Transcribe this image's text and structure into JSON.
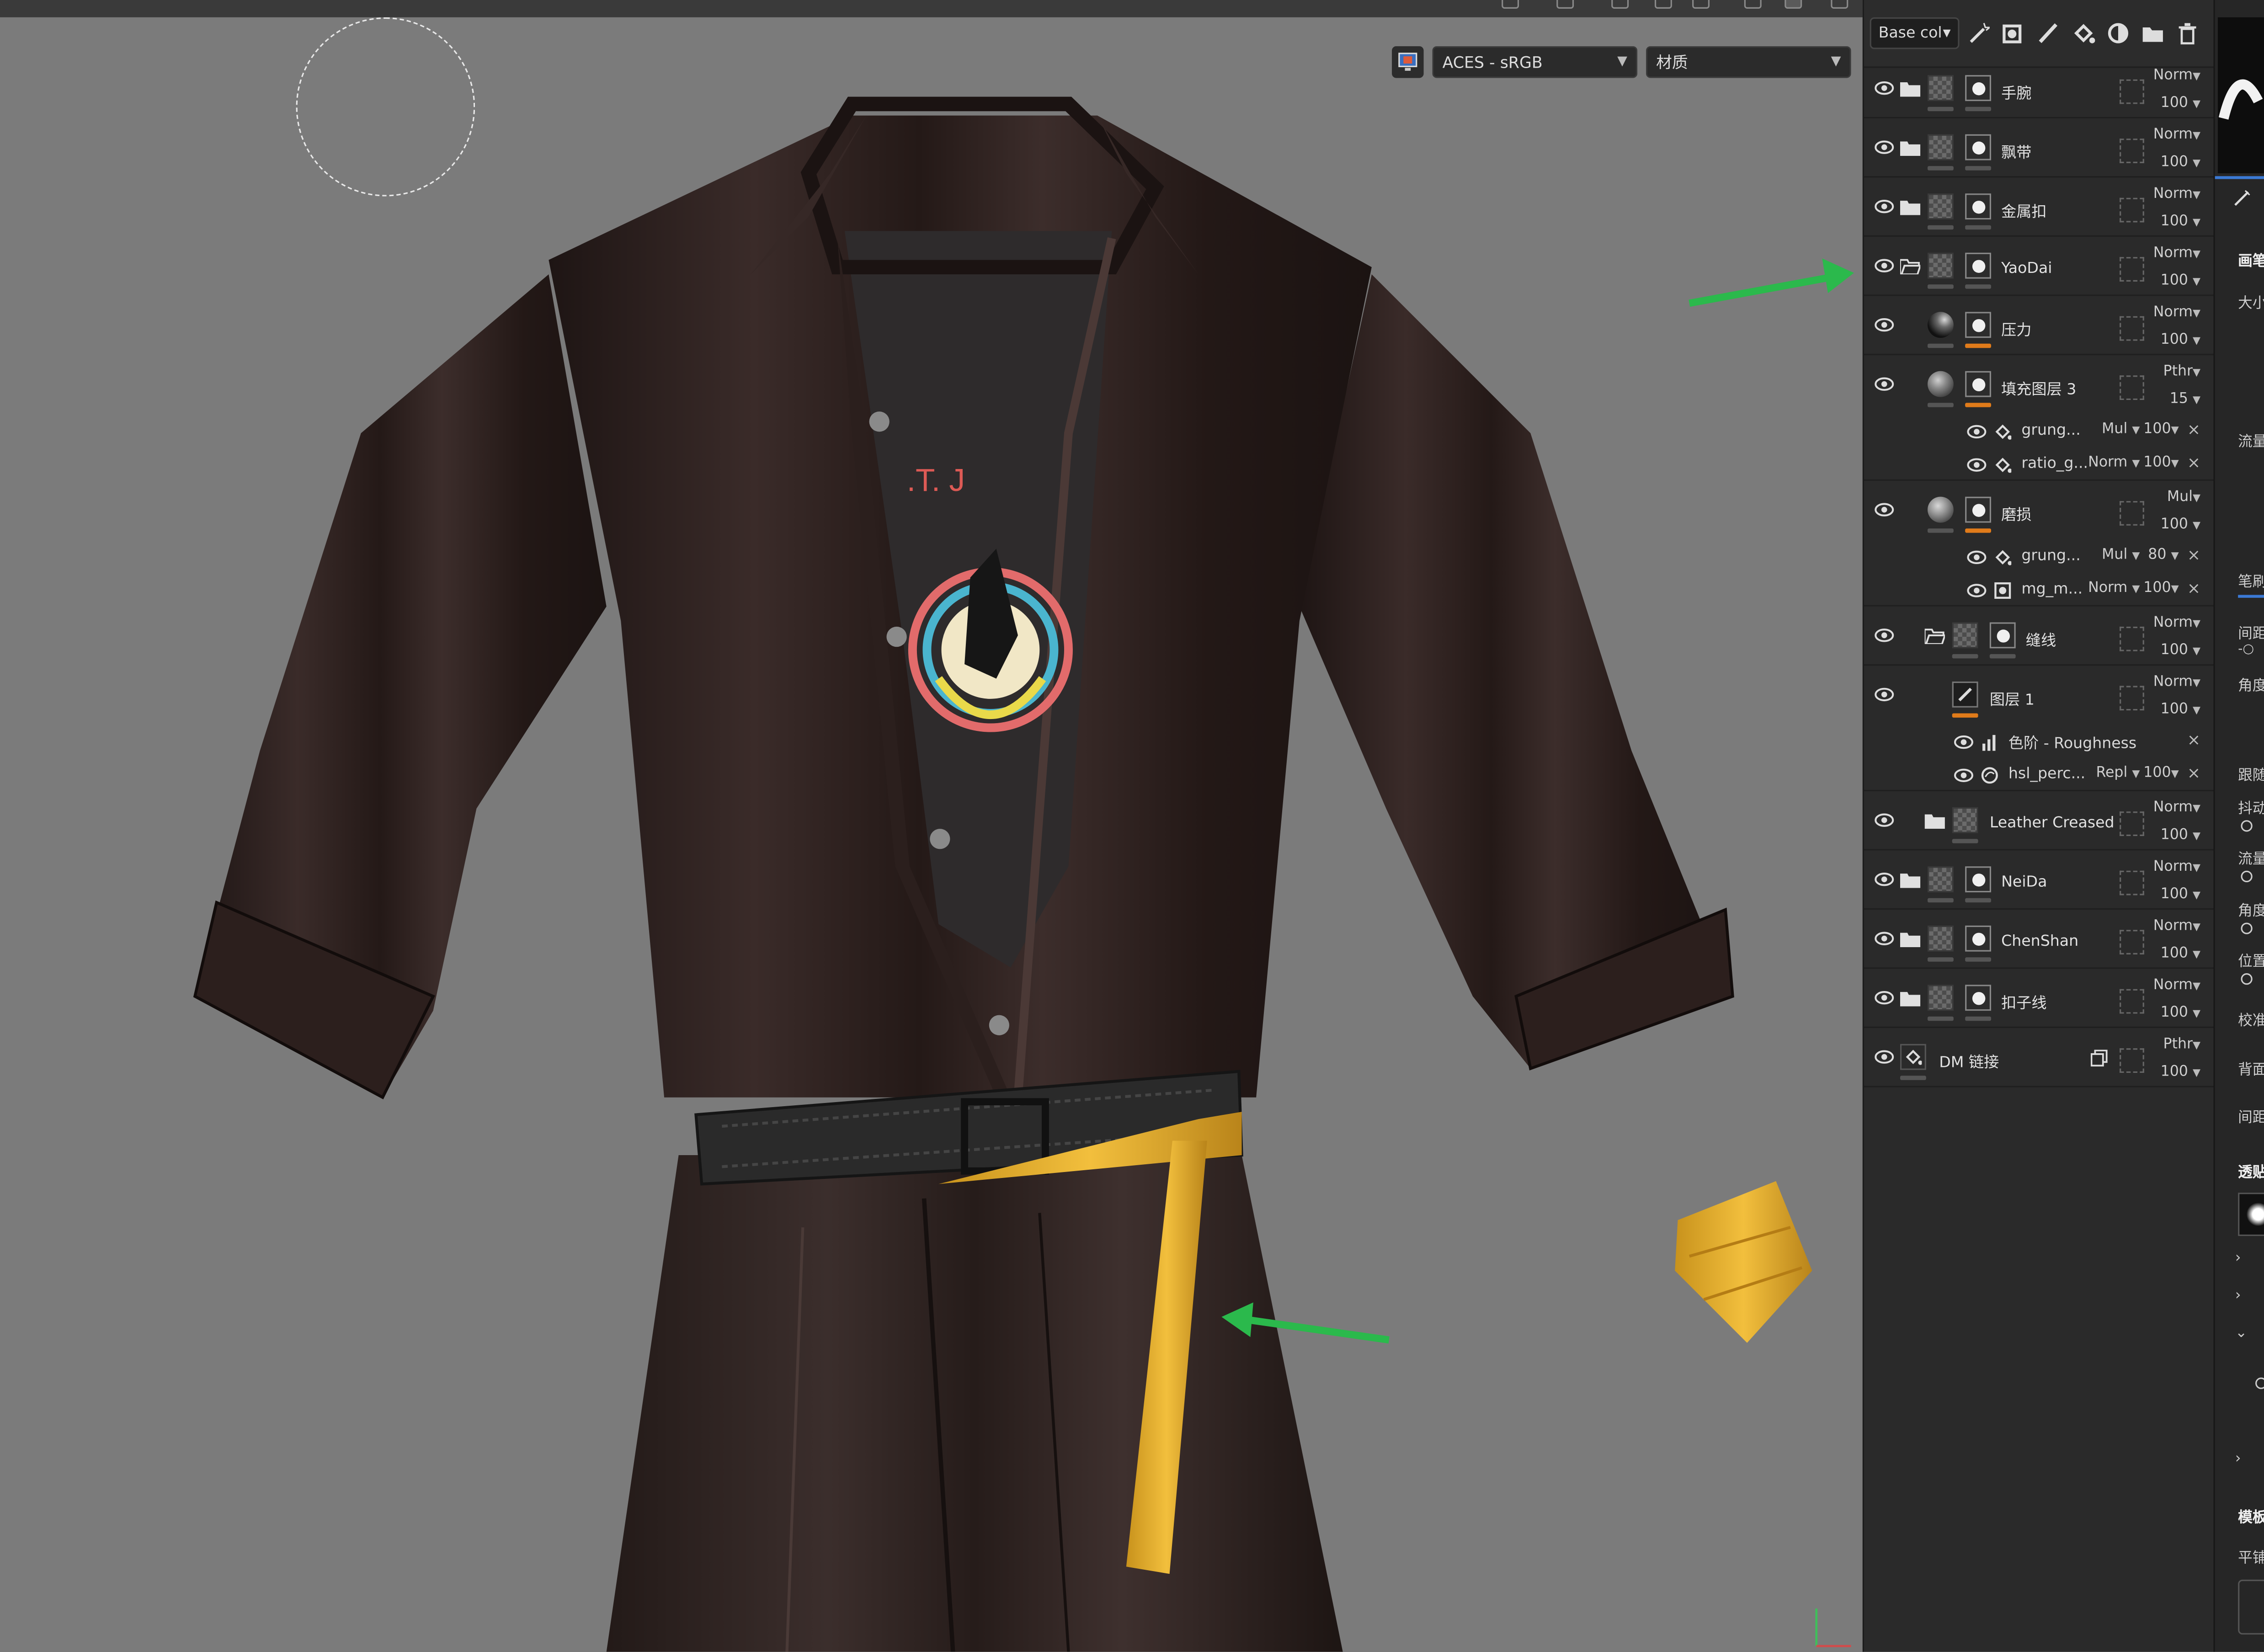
{
  "viewport": {
    "colorspace": "ACES - sRGB",
    "view_mode": "材质",
    "tshirt_text": ".T. J",
    "annotation_color": "#2bb94c"
  },
  "panel": {
    "channel": "Base col",
    "layers": [
      {
        "name": "手腕",
        "blend": "Norm",
        "opacity": "100"
      },
      {
        "name": "飘带",
        "blend": "Norm",
        "opacity": "100"
      },
      {
        "name": "金属扣",
        "blend": "Norm",
        "opacity": "100"
      },
      {
        "name": "YaoDai",
        "blend": "Norm",
        "opacity": "100"
      },
      {
        "name": "压力",
        "blend": "Norm",
        "opacity": "100"
      },
      {
        "name": "填充图层 3",
        "blend": "Pthr",
        "opacity": "15"
      },
      {
        "name": "磨损",
        "blend": "Mul",
        "opacity": "100"
      },
      {
        "name": "缝线",
        "blend": "Norm",
        "opacity": "100"
      },
      {
        "name": "图层 1",
        "blend": "Norm",
        "opacity": "100"
      },
      {
        "name": "Leather Creased",
        "blend": "Norm",
        "opacity": "100"
      },
      {
        "name": "NeiDa",
        "blend": "Norm",
        "opacity": "100"
      },
      {
        "name": "ChenShan",
        "blend": "Norm",
        "opacity": "100"
      },
      {
        "name": "扣子线",
        "blend": "Norm",
        "opacity": "100"
      },
      {
        "name": "DM 链接",
        "blend": "Pthr",
        "opacity": "100"
      }
    ],
    "effects": [
      {
        "name": "grung...",
        "blend": "Mul",
        "opacity": "100"
      },
      {
        "name": "ratio_g...",
        "blend": "Norm",
        "opacity": "100"
      },
      {
        "name": "grung...",
        "blend": "Mul",
        "opacity": "80"
      },
      {
        "name": "mg_m...",
        "blend": "Norm",
        "opacity": "100"
      },
      {
        "name": "色阶 - Roughness",
        "blend": "",
        "opacity": ""
      },
      {
        "name": "hsl_perc...",
        "blend": "Repl",
        "opacity": "100"
      }
    ]
  },
  "right_panel": {
    "labels": [
      "画笔",
      "大小",
      "流量",
      "笔刷",
      "间距",
      "角度",
      "跟随",
      "抖动",
      "流量",
      "角度",
      "位置",
      "校准",
      "背面",
      "间距",
      "透贴",
      "模板",
      "平铺"
    ]
  }
}
